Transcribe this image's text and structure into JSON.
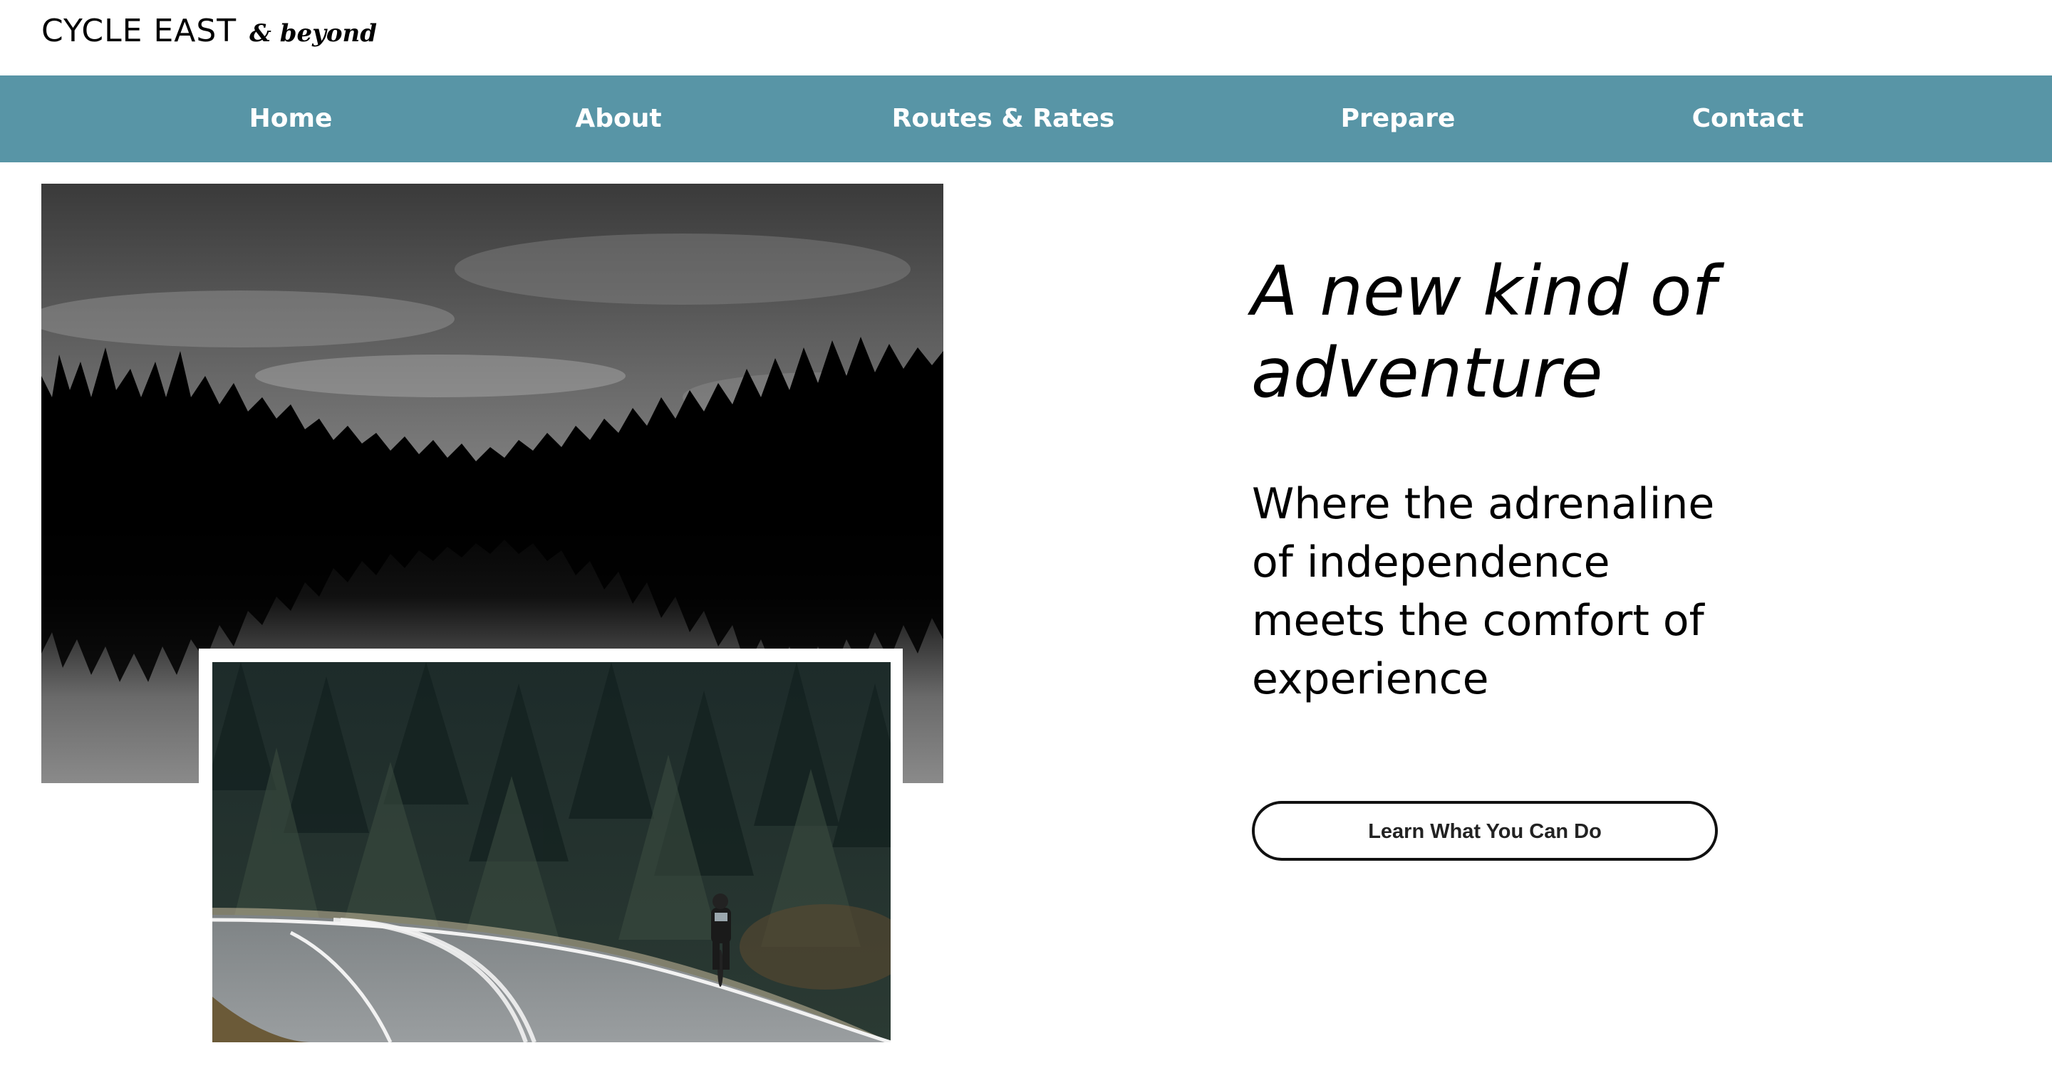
{
  "brand": {
    "name": "CYCLE EAST",
    "tagline": "& beyond"
  },
  "nav": {
    "items": [
      {
        "label": "Home"
      },
      {
        "label": "About"
      },
      {
        "label": "Routes & Rates"
      },
      {
        "label": "Prepare"
      },
      {
        "label": "Contact"
      }
    ]
  },
  "hero": {
    "title": "A new kind of adventure",
    "subtitle": "Where the adrenaline of independence meets the comfort of experience",
    "cta_label": "Learn What You Can Do"
  },
  "colors": {
    "nav_background": "#5895a6",
    "nav_text": "#ffffff",
    "text": "#000000",
    "button_border": "#111111"
  }
}
